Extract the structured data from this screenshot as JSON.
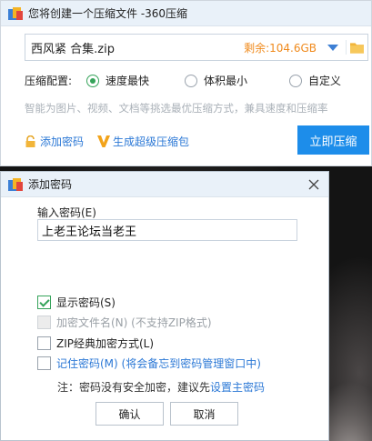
{
  "main_window": {
    "title": "您将创建一个压缩文件 -360压缩",
    "file_name": "西风紧 合集.zip",
    "free_space": "剩余:104.6GB",
    "config_label": "压缩配置:",
    "options": [
      {
        "label": "速度最快",
        "selected": true
      },
      {
        "label": "体积最小",
        "selected": false
      },
      {
        "label": "自定义",
        "selected": false
      }
    ],
    "hint": "智能为图片、视频、文档等挑选最优压缩方式，兼具速度和压缩率",
    "add_password": "添加密码",
    "make_sfx": "生成超级压缩包",
    "compress_now": "立即压缩"
  },
  "dialog": {
    "title": "添加密码",
    "input_label": "输入密码(E)",
    "password_value": "上老王论坛当老王",
    "checkboxes": [
      {
        "label": "显示密码(S)",
        "checked": true,
        "disabled": false,
        "style": "normal"
      },
      {
        "label": "加密文件名(N) (不支持ZIP格式)",
        "checked": false,
        "disabled": true,
        "style": "disabled"
      },
      {
        "label": "ZIP经典加密方式(L)",
        "checked": false,
        "disabled": false,
        "style": "normal"
      },
      {
        "label": "记住密码(M) (将会备忘到密码管理窗口中)",
        "checked": false,
        "disabled": false,
        "style": "blue"
      }
    ],
    "note_prefix": "注：密码没有安全加密，建议先",
    "note_link": "设置主密码",
    "ok": "确认",
    "cancel": "取消"
  },
  "colors": {
    "accent": "#1d8dea",
    "link": "#2b78d6",
    "check": "#35a35a",
    "free_space": "#f08a1c"
  }
}
